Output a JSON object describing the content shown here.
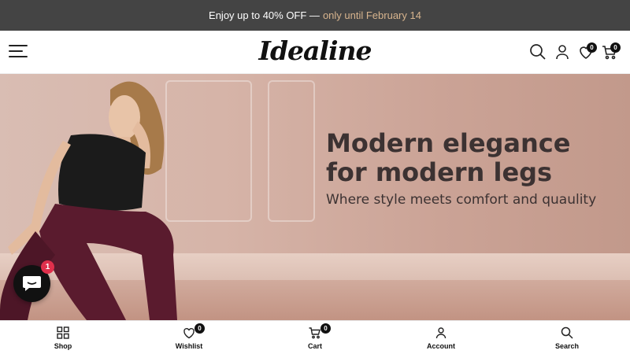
{
  "announcement": {
    "text": "Enjoy up to 40% OFF —",
    "highlight": "only until February 14",
    "highlight_color": "#d7b48e"
  },
  "header": {
    "logo_text": "Idealine",
    "wishlist_count": "0",
    "cart_count": "0"
  },
  "hero": {
    "title_line1": "Modern elegance",
    "title_line2": "for modern legs",
    "subtitle": "Where style meets comfort and quaulity",
    "background_color": "#d6b4a8",
    "text_color": "#3c3232"
  },
  "chat": {
    "unread_count": "1"
  },
  "bottom_nav": {
    "items": [
      {
        "label": "Shop",
        "icon": "grid-icon"
      },
      {
        "label": "Wishlist",
        "icon": "heart-icon",
        "badge": "0"
      },
      {
        "label": "Cart",
        "icon": "cart-icon",
        "badge": "0"
      },
      {
        "label": "Account",
        "icon": "user-icon"
      },
      {
        "label": "Search",
        "icon": "search-icon"
      }
    ]
  }
}
